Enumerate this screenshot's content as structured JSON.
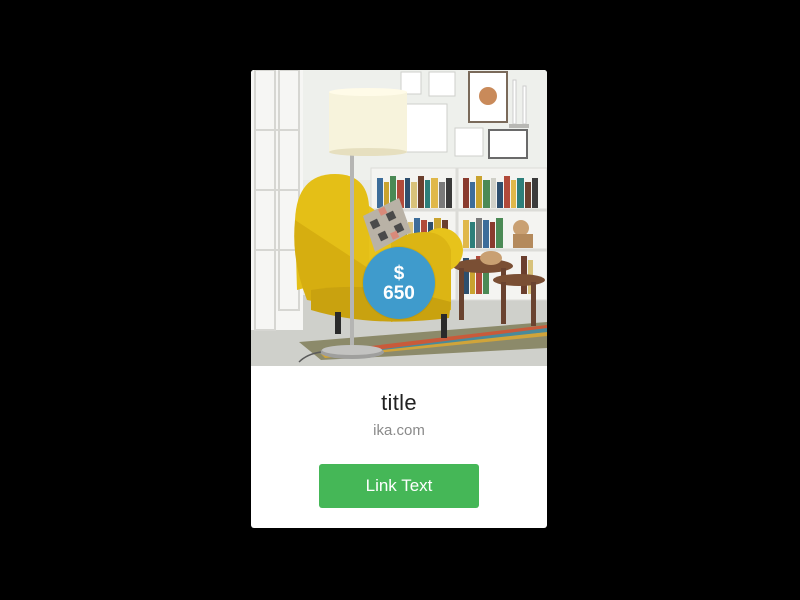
{
  "card": {
    "price": {
      "currency": "$",
      "amount": "650"
    },
    "title": "title",
    "subtitle": "ika.com",
    "link_label": "Link Text"
  },
  "colors": {
    "page_background": "#000000",
    "card_background": "#ffffff",
    "price_badge": "#3f9bcc",
    "button": "#45b757",
    "chair": "#e7c31b"
  },
  "image": {
    "description_icon": "living-room-photo"
  }
}
